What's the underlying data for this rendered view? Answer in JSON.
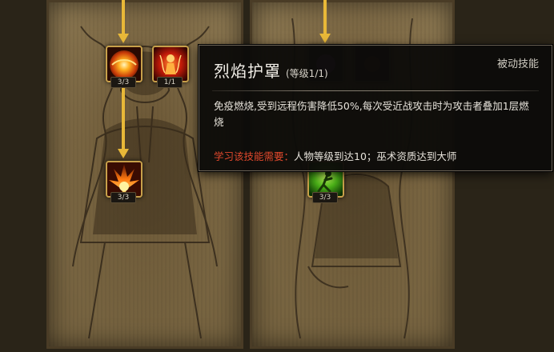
{
  "skill_tree": {
    "nodes": [
      {
        "name": "fire-orb",
        "level_text": "3/3",
        "learned": true
      },
      {
        "name": "fire-figure",
        "level_text": "1/1",
        "learned": true
      },
      {
        "name": "flame-burst",
        "level_text": "3/3",
        "learned": true
      },
      {
        "name": "poison-figure",
        "level_text": "3/3",
        "learned": true
      }
    ]
  },
  "tooltip": {
    "title": "烈焰护罩",
    "level": "(等级1/1)",
    "type": "被动技能",
    "description": "免疫燃烧,受到远程伤害降低50%,每次受近战攻击时为攻击者叠加1层燃烧",
    "requirement_label": "学习该技能需要：",
    "requirement_value": "人物等级到达10；巫术资质达到大师"
  },
  "colors": {
    "requirement_label": "#e0482c",
    "icon_frame": "#c8a04a",
    "connector_arrow": "#e8b838"
  }
}
